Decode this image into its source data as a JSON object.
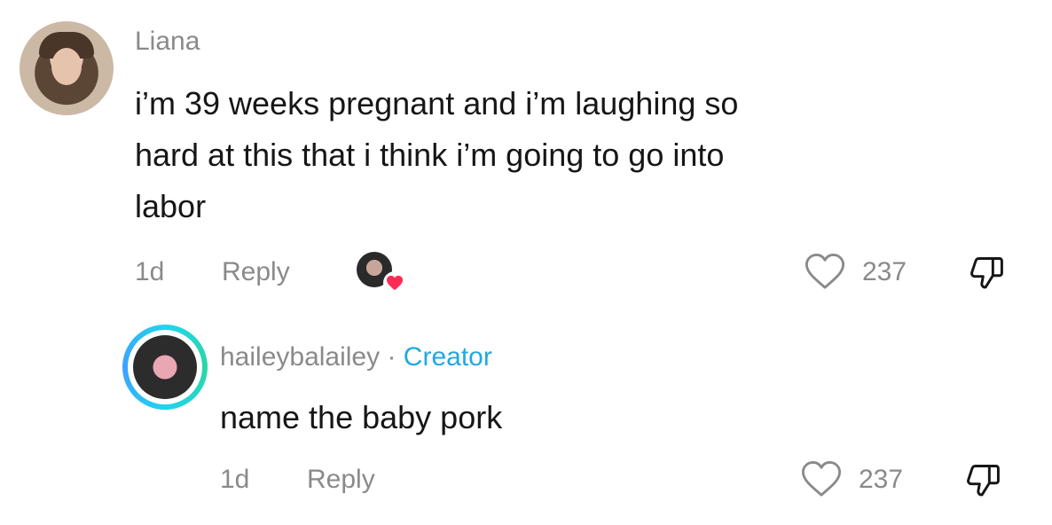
{
  "comment": {
    "username": "Liana",
    "text_line1": "i’m 39 weeks pregnant and i’m laughing so",
    "text_line2": "hard at this that i think i’m going to go into",
    "text_line3": "labor",
    "age": "1d",
    "reply_label": "Reply",
    "like_count": "237"
  },
  "reply": {
    "username": "haileybalailey",
    "separator": " · ",
    "creator_label": "Creator",
    "text": "name the baby pork",
    "age": "1d",
    "reply_label": "Reply",
    "like_count": "237"
  },
  "icons": {
    "heart": "heart-icon",
    "dislike": "dislike-icon",
    "liked_by_creator": "liked-by-creator-badge"
  },
  "colors": {
    "creator_accent": "#20a9e0",
    "liked_heart": "#fe2c55",
    "text": "#161616",
    "muted": "#8a8a8a"
  }
}
